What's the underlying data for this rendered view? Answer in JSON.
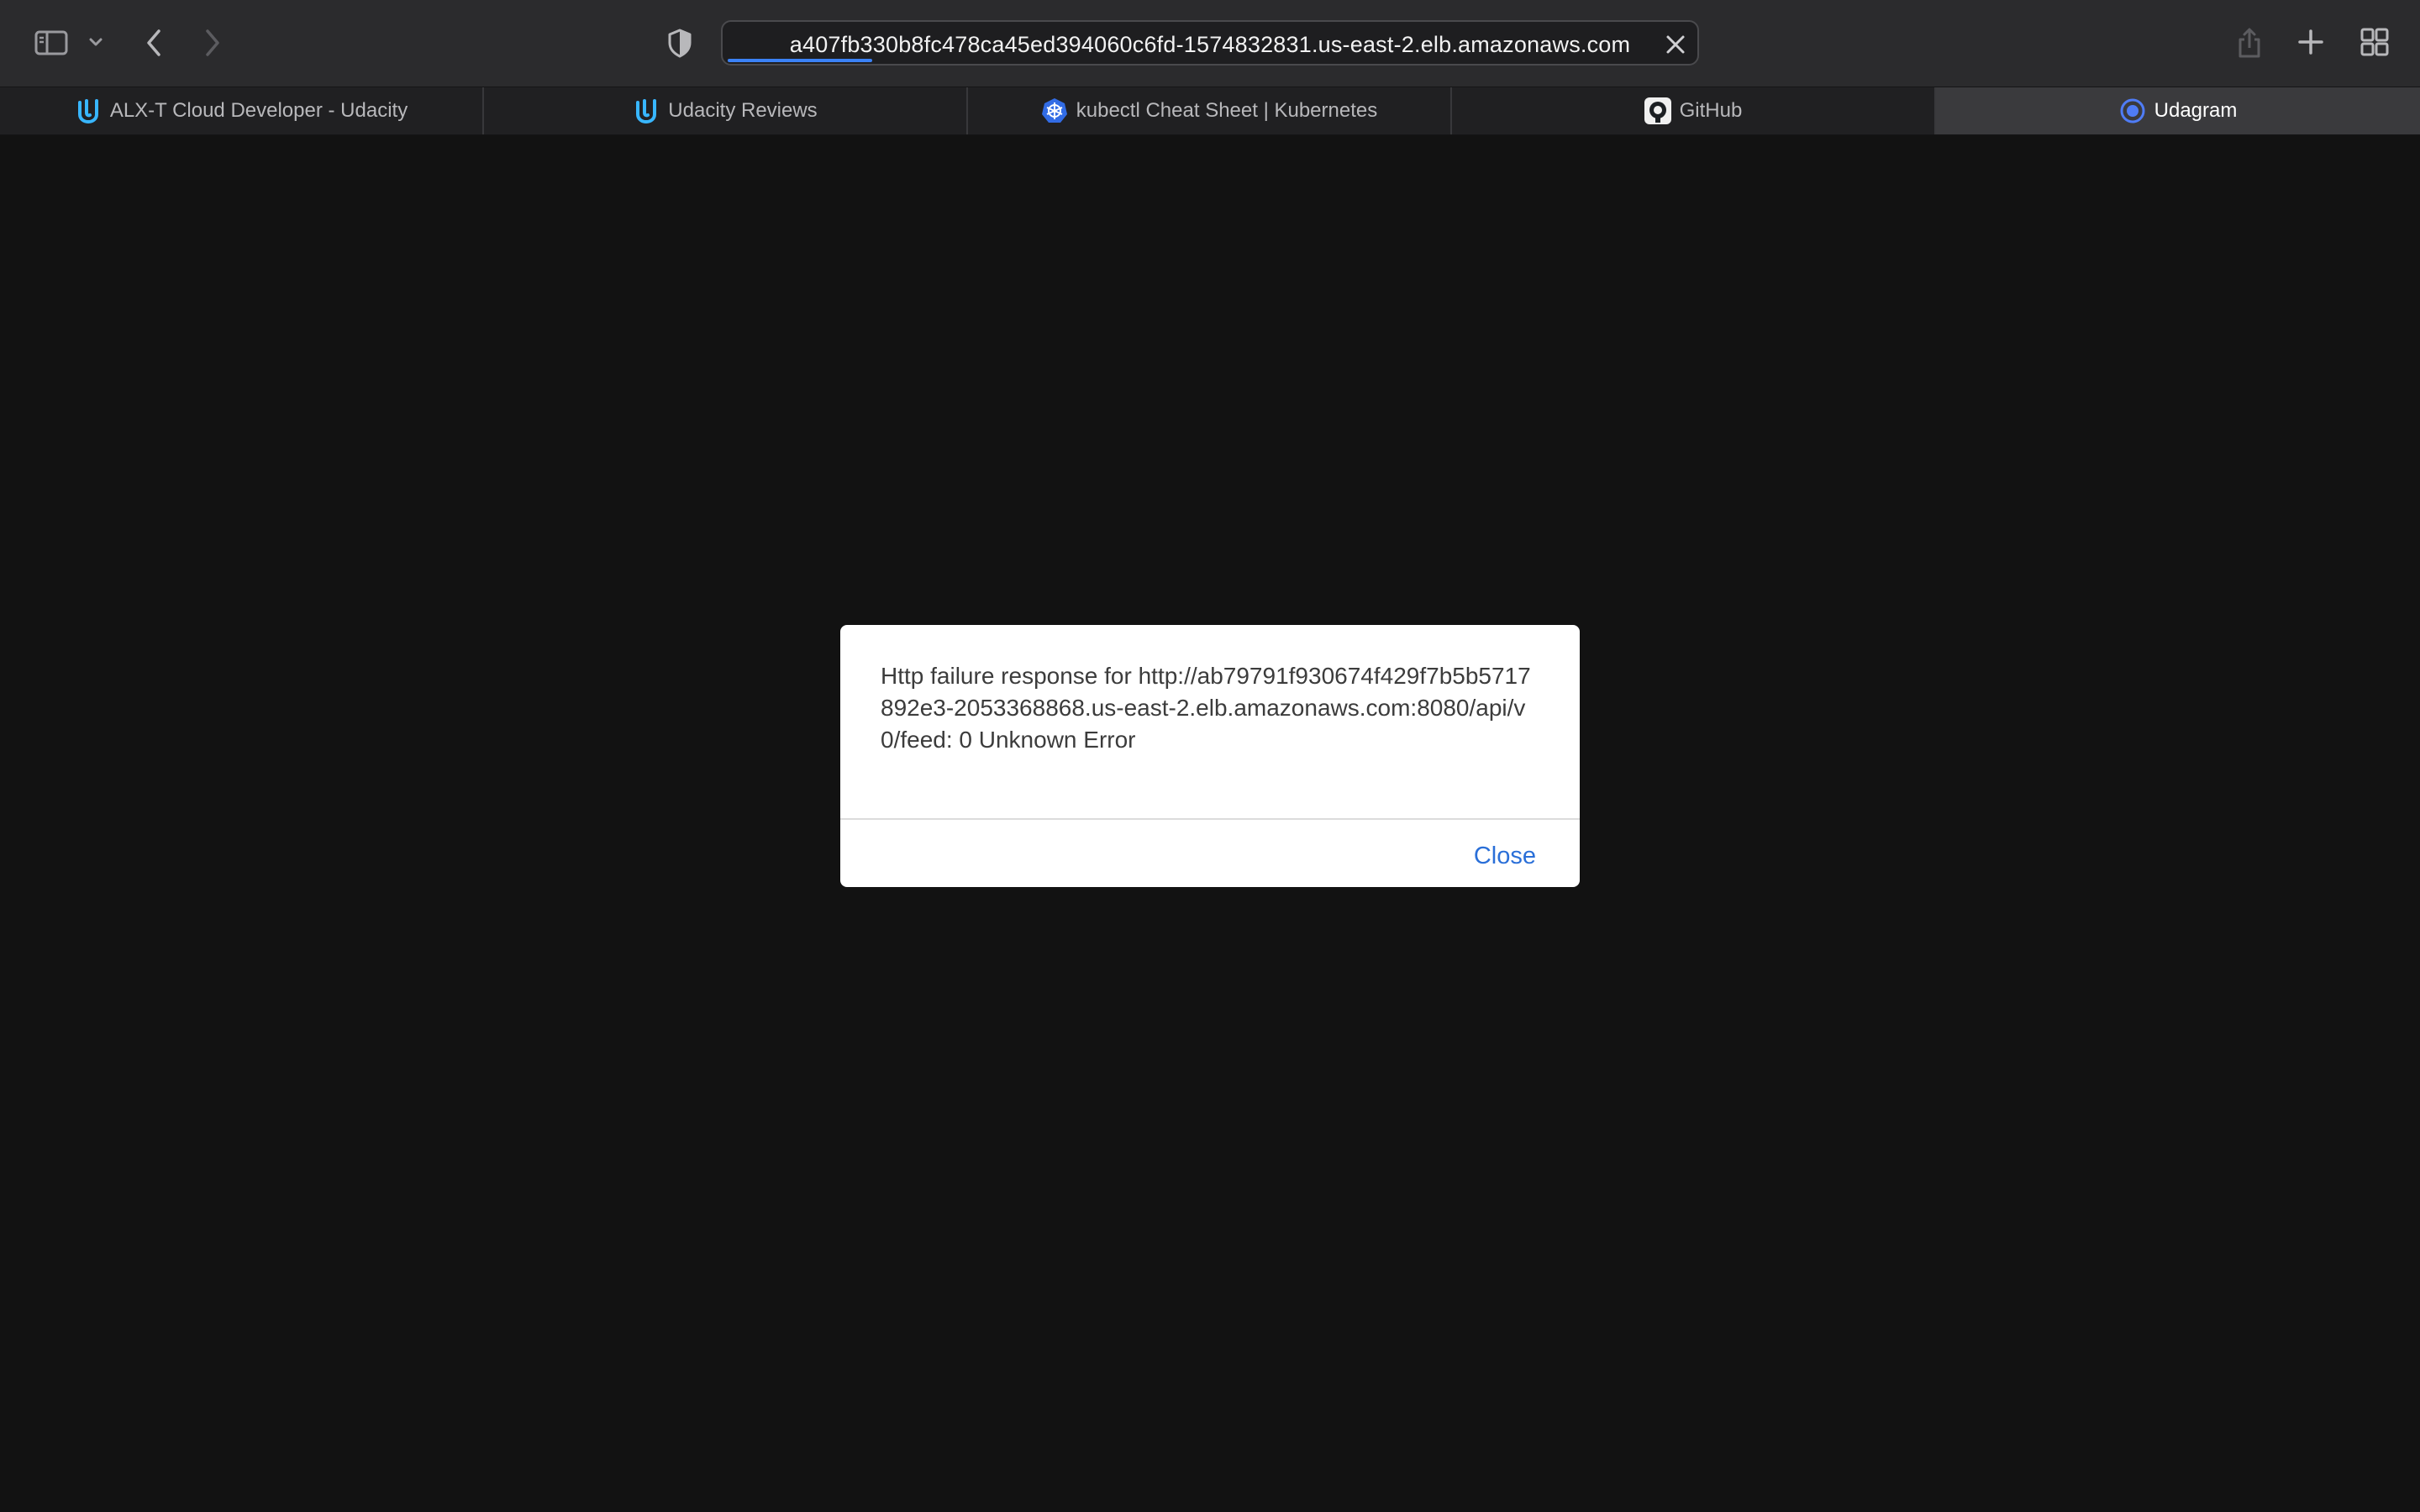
{
  "browser": {
    "address_bar": {
      "url": "a407fb330b8fc478ca45ed394060c6fd-1574832831.us-east-2.elb.amazonaws.com",
      "load_progress_fraction": 0.15
    },
    "toolbar_icons": {
      "sidebar": "sidebar-icon",
      "sidebar_menu": "chevron-down-icon",
      "back": "back-arrow-icon",
      "forward": "forward-arrow-icon",
      "privacy": "privacy-shield-icon",
      "clear_url": "close-icon",
      "share": "share-icon",
      "new_tab": "plus-icon",
      "tab_overview": "tab-overview-icon"
    },
    "tabs": [
      {
        "label": "ALX-T Cloud Developer - Udacity",
        "icon": "udacity-icon",
        "active": false
      },
      {
        "label": "Udacity Reviews",
        "icon": "udacity-icon",
        "active": false
      },
      {
        "label": "kubectl Cheat Sheet | Kubernetes",
        "icon": "kubernetes-icon",
        "active": false
      },
      {
        "label": "GitHub",
        "icon": "github-icon",
        "active": false
      },
      {
        "label": "Udagram",
        "icon": "udagram-icon",
        "active": true
      }
    ]
  },
  "dialog": {
    "message": "Http failure response for http://ab79791f930674f429f7b5b5717892e3-2053368868.us-east-2.elb.amazonaws.com:8080/api/v0/feed: 0 Unknown Error",
    "close_label": "Close"
  },
  "colors": {
    "page_background": "#121212",
    "toolbar_background": "#2b2b2d",
    "accent": "#3b82f6",
    "link": "#2a6fd8"
  }
}
